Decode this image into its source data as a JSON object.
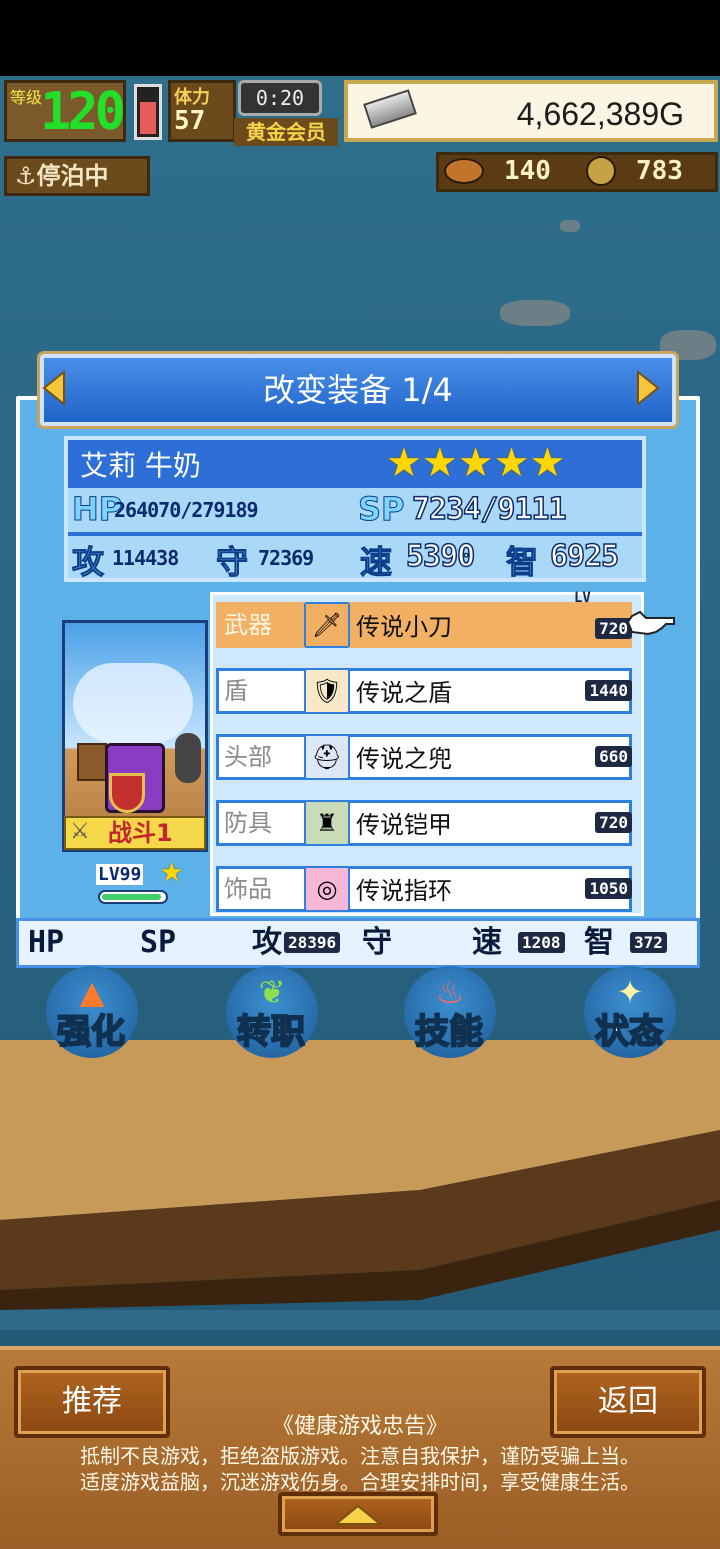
{
  "hud": {
    "level_label": "等级",
    "level_value": "120",
    "stamina_label": "体力",
    "stamina": "57",
    "timer": "0:20",
    "member": "黄金会员",
    "gold": "4,662,389G",
    "status": "⚓停泊中",
    "resource_a": "140",
    "resource_b": "783",
    "stamina_fraction": 0.65
  },
  "panel": {
    "title": "改变装备 1/4",
    "character": {
      "name": "艾莉 牛奶",
      "stars": "★★★★★",
      "hp_label": "HP",
      "hp": "264070/279189",
      "sp_label": "SP",
      "sp": "7234/9111",
      "atk_label": "攻",
      "atk": "114438",
      "def_label": "守",
      "def": "72369",
      "spd_label": "速",
      "spd": "5390",
      "int_label": "智",
      "int": "6925",
      "battle_tag": "战斗1",
      "level": "LV99",
      "exp_fraction": 0.95
    },
    "lv_header": "LV",
    "equipment": [
      {
        "slot": "武器",
        "name": "传说小刀",
        "lv": "720",
        "icon": "knife-icon"
      },
      {
        "slot": "盾",
        "name": "传说之盾",
        "lv": "1440",
        "icon": "shield-icon"
      },
      {
        "slot": "头部",
        "name": "传说之兜",
        "lv": "660",
        "icon": "helmet-icon"
      },
      {
        "slot": "防具",
        "name": "传说铠甲",
        "lv": "720",
        "icon": "armor-icon"
      },
      {
        "slot": "饰品",
        "name": "传说指环",
        "lv": "1050",
        "icon": "ring-icon"
      }
    ],
    "bottom_stats": {
      "hp_label": "HP",
      "sp_label": "SP",
      "atk_label": "攻",
      "atk": "28396",
      "def_label": "守",
      "spd_label": "速",
      "spd": "1208",
      "int_label": "智",
      "int": "372"
    }
  },
  "actions": [
    {
      "label": "强化",
      "icon": "arrow-up-icon"
    },
    {
      "label": "转职",
      "icon": "leaf-icon"
    },
    {
      "label": "技能",
      "icon": "flame-icon"
    },
    {
      "label": "状态",
      "icon": "sparkle-icon"
    }
  ],
  "footer": {
    "recommend": "推荐",
    "back": "返回",
    "advice_title": "《健康游戏忠告》",
    "advice_line1": "抵制不良游戏，拒绝盗版游戏。注意自我保护，谨防受骗上当。",
    "advice_line2": "适度游戏益脑，沉迷游戏伤身。合理安排时间，享受健康生活。"
  },
  "colors": {
    "panel_blue": "#5cb2e8",
    "title_blue": "#1f63c9",
    "selected_row": "#f2b064",
    "wood": "#9a5e26"
  }
}
